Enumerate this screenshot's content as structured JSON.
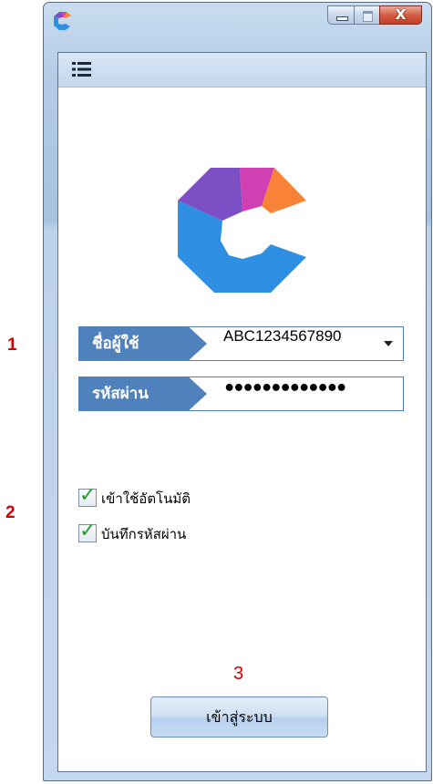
{
  "window": {
    "close_glyph": "X"
  },
  "login_form": {
    "username_label": "ชื่อผู้ใช้",
    "username_value": "ABC1234567890",
    "password_label": "รหัสผ่าน",
    "password_value": "•••••••••••••"
  },
  "options": {
    "auto_login_label": "เข้าใช้อัตโนมัติ",
    "auto_login_checked": true,
    "save_password_label": "บันทึกรหัสผ่าน",
    "save_password_checked": true,
    "check_glyph": "✓"
  },
  "login_button_label": "เข้าสู่ระบบ",
  "annotations": {
    "marker_1": "1",
    "marker_2": "2",
    "marker_3": "3"
  },
  "colors": {
    "logo_purple": "#7c4fc4",
    "logo_magenta": "#d040b2",
    "logo_orange": "#f88238",
    "logo_blue": "#2e8fe3",
    "label_blue": "#4f81bd",
    "annotation_red": "#d40000"
  }
}
